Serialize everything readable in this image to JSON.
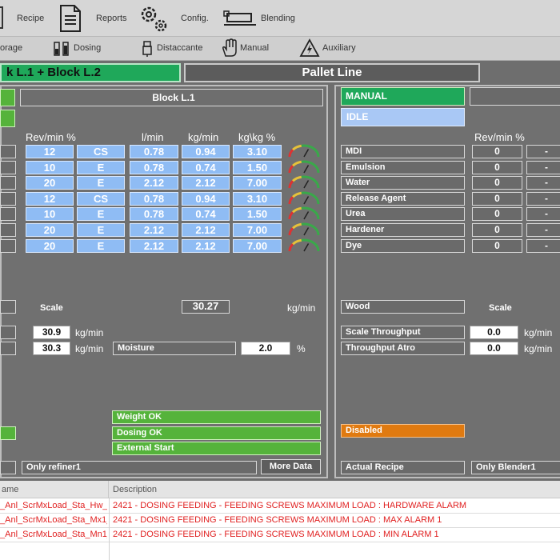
{
  "menu": {
    "recipe": "Recipe",
    "reports": "Reports",
    "config": "Config.",
    "blending": "Blending",
    "storage": "orage",
    "dosing": "Dosing",
    "distaccante": "Distaccante",
    "manual": "Manual",
    "auxiliary": "Auxiliary"
  },
  "tabs": {
    "block": "k L.1 + Block L.2",
    "pallet": "Pallet Line"
  },
  "left": {
    "title": "Block L.1",
    "headers": {
      "rev": "Rev/min %",
      "lmin": "l/min",
      "kgmin": "kg/min",
      "kgkg": "kg\\kg %"
    },
    "rows": [
      {
        "rev": "12",
        "mode": "CS",
        "lmin": "0.78",
        "kgmin": "0.94",
        "kgkg": "3.10"
      },
      {
        "rev": "10",
        "mode": "E",
        "lmin": "0.78",
        "kgmin": "0.74",
        "kgkg": "1.50"
      },
      {
        "rev": "20",
        "mode": "E",
        "lmin": "2.12",
        "kgmin": "2.12",
        "kgkg": "7.00"
      },
      {
        "rev": "12",
        "mode": "CS",
        "lmin": "0.78",
        "kgmin": "0.94",
        "kgkg": "3.10"
      },
      {
        "rev": "10",
        "mode": "E",
        "lmin": "0.78",
        "kgmin": "0.74",
        "kgkg": "1.50"
      },
      {
        "rev": "20",
        "mode": "E",
        "lmin": "2.12",
        "kgmin": "2.12",
        "kgkg": "7.00"
      },
      {
        "rev": "20",
        "mode": "E",
        "lmin": "2.12",
        "kgmin": "2.12",
        "kgkg": "7.00"
      }
    ],
    "scale_label": "Scale",
    "scale_value": "30.27",
    "scale_unit": "kg/min",
    "flow1": "30.9",
    "flow1_unit": "kg/min",
    "flow2": "30.3",
    "flow2_unit": "kg/min",
    "moisture_label": "Moisture",
    "moisture_value": "2.0",
    "moisture_unit": "%",
    "weight_ok": "Weight OK",
    "dosing_ok": "Dosing OK",
    "external_start": "External Start",
    "only_refiner": "Only refiner1",
    "more_data": "More Data"
  },
  "right": {
    "mode": "MANUAL",
    "state": "IDLE",
    "rev_header": "Rev/min %",
    "rows": [
      {
        "name": "MDI",
        "value": "0",
        "dash": "-"
      },
      {
        "name": "Emulsion",
        "value": "0",
        "dash": "-"
      },
      {
        "name": "Water",
        "value": "0",
        "dash": "-"
      },
      {
        "name": "Release Agent",
        "value": "0",
        "dash": "-"
      },
      {
        "name": "Urea",
        "value": "0",
        "dash": "-"
      },
      {
        "name": "Hardener",
        "value": "0",
        "dash": "-"
      },
      {
        "name": "Dye",
        "value": "0",
        "dash": "-"
      }
    ],
    "wood": "Wood",
    "scale_label": "Scale",
    "scale_throughput": "Scale Throughput",
    "scale_throughput_value": "0.0",
    "scale_throughput_unit": "kg/min",
    "throughput_atro": "Throughput Atro",
    "throughput_atro_value": "0.0",
    "throughput_atro_unit": "kg/min",
    "disabled": "Disabled",
    "actual_recipe": "Actual Recipe",
    "only_blender": "Only Blender1"
  },
  "alarms": {
    "col_name": "ame",
    "col_desc": "Description",
    "rows": [
      {
        "name": "_Anl_ScrMxLoad_Sta_Hw_Al...",
        "desc": "2421 - DOSING FEEDING - FEEDING SCREWS MAXIMUM LOAD : HARDWARE ALARM"
      },
      {
        "name": "_Anl_ScrMxLoad_Sta_Mx1_...",
        "desc": "2421 - DOSING FEEDING - FEEDING SCREWS MAXIMUM LOAD : MAX ALARM 1"
      },
      {
        "name": "_Anl_ScrMxLoad_Sta_Mn1_...",
        "desc": "2421 - DOSING FEEDING - FEEDING SCREWS MAXIMUM LOAD : MIN ALARM 1"
      }
    ]
  },
  "colors": {
    "green": "#55b33b",
    "blue": "#8fbcf4",
    "orange": "#e07a10",
    "alarm_red": "#e02020"
  }
}
